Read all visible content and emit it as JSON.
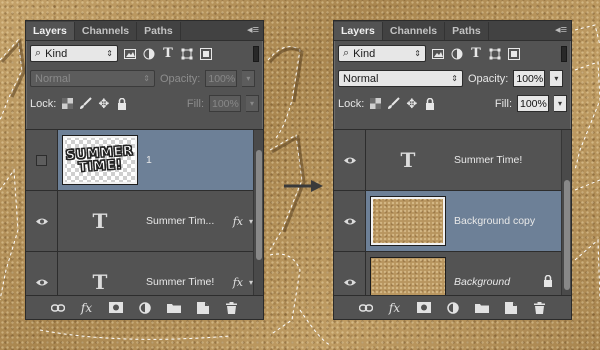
{
  "tabs": [
    "Layers",
    "Channels",
    "Paths"
  ],
  "filter_kind": "Kind",
  "icons": {
    "panel_menu": "panel-menu-icon",
    "filter_pixel": "image-icon",
    "filter_adjust": "adjustment-icon",
    "filter_type": "type-icon",
    "filter_shape": "shape-icon",
    "filter_smart": "smart-object-icon",
    "lock_transparent": "checker-lock-icon",
    "lock_paint": "brush-icon",
    "lock_position": "move-icon",
    "lock_all": "lock-icon",
    "eye": "eye-icon"
  },
  "labels": {
    "lock": "Lock:",
    "opacity": "Opacity:",
    "fill": "Fill:"
  },
  "left_panel": {
    "blend_mode": "Normal",
    "opacity": "100%",
    "fill": "100%",
    "layers": [
      {
        "name": "1",
        "thumb_text": "SUMMER TIME!",
        "visible": false,
        "selected": true,
        "type": "raster"
      },
      {
        "name": "Summer Tim...",
        "fx": "fx",
        "visible": true,
        "selected": false,
        "type": "text"
      },
      {
        "name": "Summer Time!",
        "fx": "fx",
        "visible": true,
        "selected": false,
        "type": "text"
      }
    ]
  },
  "right_panel": {
    "blend_mode": "Normal",
    "opacity": "100%",
    "fill": "100%",
    "layers": [
      {
        "name": "Summer Time!",
        "visible": true,
        "selected": false,
        "type": "text"
      },
      {
        "name": "Background copy",
        "visible": true,
        "selected": true,
        "type": "image"
      },
      {
        "name": "Background",
        "visible": true,
        "selected": false,
        "type": "image",
        "locked": true
      }
    ]
  },
  "footer_buttons": [
    "link-icon",
    "fx-icon",
    "mask-icon",
    "adjustment-layer-icon",
    "folder-icon",
    "new-layer-icon",
    "trash-icon"
  ],
  "fx_label": "fx",
  "type_glyph": "T",
  "colors": {
    "selection": "#6d8097",
    "panel_bg": "#535353"
  }
}
